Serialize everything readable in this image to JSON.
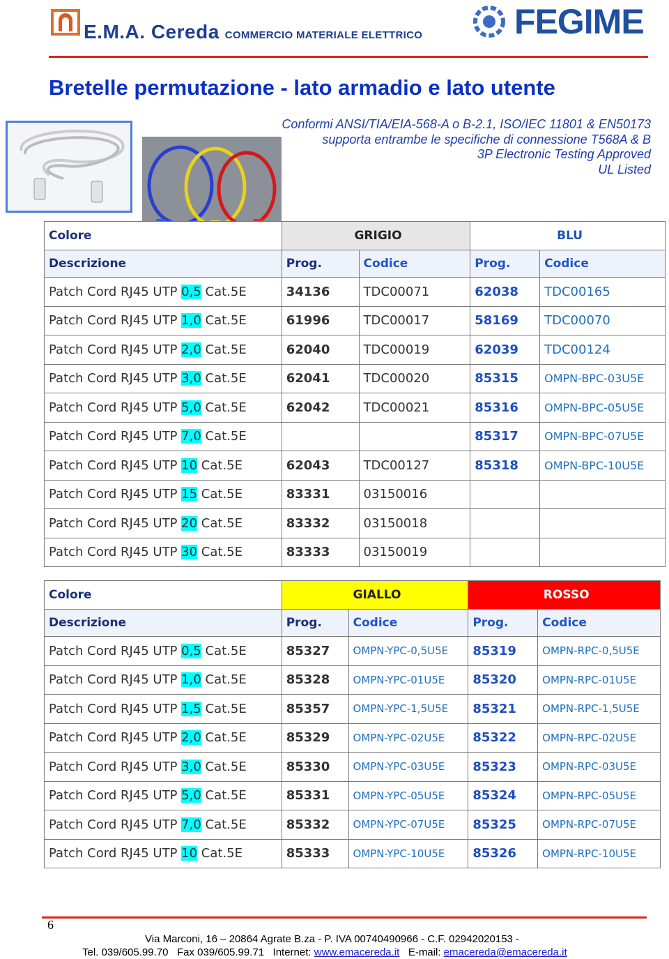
{
  "header": {
    "brand": "E.M.A. Cereda",
    "brand_sub": "COMMERCIO MATERIALE ELETTRICO",
    "partner_logo": "FEGIME"
  },
  "title": "Bretelle permutazione  - lato armadio e lato utente",
  "specs": [
    "Conformi ANSI/TIA/EIA-568-A o B-2.1, ISO/IEC 11801 & EN50173",
    "supporta entrambe le specifiche di connessione T568A & B",
    "3P Electronic Testing Approved",
    "UL Listed"
  ],
  "table1": {
    "colore_label": "Colore",
    "color1": "GRIGIO",
    "color2": "BLU",
    "descr_label": "Descrizione",
    "prog_label": "Prog.",
    "codice_label": "Codice",
    "rows": [
      {
        "pre": "Patch Cord RJ45 UTP ",
        "len": "0,5",
        "post": " Cat.5E",
        "p1": "34136",
        "c1": "TDC00071",
        "p2": "62038",
        "c2": "TDC00165"
      },
      {
        "pre": "Patch Cord RJ45 UTP ",
        "len": "1,0",
        "post": " Cat.5E",
        "p1": "61996",
        "c1": "TDC00017",
        "p2": "58169",
        "c2": "TDC00070"
      },
      {
        "pre": "Patch Cord RJ45 UTP ",
        "len": "2,0",
        "post": " Cat.5E",
        "p1": "62040",
        "c1": "TDC00019",
        "p2": "62039",
        "c2": "TDC00124"
      },
      {
        "pre": "Patch Cord RJ45 UTP ",
        "len": "3,0",
        "post": " Cat.5E",
        "p1": "62041",
        "c1": "TDC00020",
        "p2": "85315",
        "c2": "OMPN-BPC-03U5E"
      },
      {
        "pre": "Patch Cord RJ45 UTP ",
        "len": "5,0",
        "post": " Cat.5E",
        "p1": "62042",
        "c1": "TDC00021",
        "p2": "85316",
        "c2": "OMPN-BPC-05U5E"
      },
      {
        "pre": "Patch Cord RJ45 UTP ",
        "len": "7,0",
        "post": " Cat.5E",
        "p1": "",
        "c1": "",
        "p2": "85317",
        "c2": "OMPN-BPC-07U5E"
      },
      {
        "pre": "Patch Cord RJ45 UTP ",
        "len": "10",
        "post": " Cat.5E",
        "p1": "62043",
        "c1": "TDC00127",
        "p2": "85318",
        "c2": "OMPN-BPC-10U5E"
      },
      {
        "pre": "Patch Cord RJ45 UTP ",
        "len": "15",
        "post": " Cat.5E",
        "p1": "83331",
        "c1": "03150016",
        "p2": "",
        "c2": ""
      },
      {
        "pre": "Patch Cord RJ45 UTP ",
        "len": "20",
        "post": " Cat.5E",
        "p1": "83332",
        "c1": "03150018",
        "p2": "",
        "c2": ""
      },
      {
        "pre": "Patch Cord RJ45 UTP ",
        "len": "30",
        "post": " Cat.5E",
        "p1": "83333",
        "c1": "03150019",
        "p2": "",
        "c2": ""
      }
    ]
  },
  "table2": {
    "colore_label": "Colore",
    "color1": "GIALLO",
    "color2": "ROSSO",
    "descr_label": "Descrizione",
    "prog_label": "Prog.",
    "codice_label": "Codice",
    "rows": [
      {
        "pre": "Patch Cord RJ45 UTP ",
        "len": "0,5",
        "post": " Cat.5E",
        "p1": "85327",
        "c1": "OMPN-YPC-0,5U5E",
        "p2": "85319",
        "c2": "OMPN-RPC-0,5U5E"
      },
      {
        "pre": "Patch Cord RJ45 UTP ",
        "len": "1,0",
        "post": " Cat.5E",
        "p1": "85328",
        "c1": "OMPN-YPC-01U5E",
        "p2": "85320",
        "c2": "OMPN-RPC-01U5E"
      },
      {
        "pre": "Patch Cord RJ45 UTP ",
        "len": "1,5",
        "post": " Cat.5E",
        "p1": "85357",
        "c1": "OMPN-YPC-1,5U5E",
        "p2": "85321",
        "c2": "OMPN-RPC-1,5U5E"
      },
      {
        "pre": "Patch Cord RJ45 UTP ",
        "len": "2,0",
        "post": " Cat.5E",
        "p1": "85329",
        "c1": "OMPN-YPC-02U5E",
        "p2": "85322",
        "c2": "OMPN-RPC-02U5E"
      },
      {
        "pre": "Patch Cord RJ45 UTP ",
        "len": "3,0",
        "post": " Cat.5E",
        "p1": "85330",
        "c1": "OMPN-YPC-03U5E",
        "p2": "85323",
        "c2": "OMPN-RPC-03U5E"
      },
      {
        "pre": "Patch Cord RJ45 UTP ",
        "len": "5,0",
        "post": " Cat.5E",
        "p1": "85331",
        "c1": "OMPN-YPC-05U5E",
        "p2": "85324",
        "c2": "OMPN-RPC-05U5E"
      },
      {
        "pre": "Patch Cord RJ45 UTP ",
        "len": "7,0",
        "post": " Cat.5E",
        "p1": "85332",
        "c1": "OMPN-YPC-07U5E",
        "p2": "85325",
        "c2": "OMPN-RPC-07U5E"
      },
      {
        "pre": "Patch Cord RJ45 UTP ",
        "len": "10",
        "post": " Cat.5E",
        "p1": "85333",
        "c1": "OMPN-YPC-10U5E",
        "p2": "85326",
        "c2": "OMPN-RPC-10U5E"
      }
    ]
  },
  "footer": {
    "page": "6",
    "address": "Via Marconi, 16 – 20864 Agrate B.za - P. IVA 00740490966 - C.F. 02942020153 -",
    "contacts_pre": "Tel. 039/605.99.70   Fax 039/605.99.71   Internet: ",
    "web": "www.emacereda.it",
    "email_label": "   E-mail: ",
    "email": "emacereda@emacereda.it"
  },
  "colors": {
    "title": "#0a31c6",
    "rule": "#d9261c",
    "highlight": "#00ffff",
    "yellow": "#ffff00",
    "red": "#ff0000"
  }
}
